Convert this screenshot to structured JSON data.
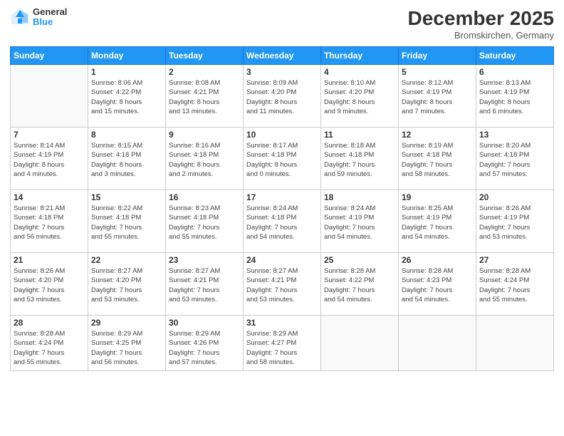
{
  "logo": {
    "general": "General",
    "blue": "Blue"
  },
  "title": "December 2025",
  "subtitle": "Bromskirchen, Germany",
  "weekdays": [
    "Sunday",
    "Monday",
    "Tuesday",
    "Wednesday",
    "Thursday",
    "Friday",
    "Saturday"
  ],
  "weeks": [
    [
      {
        "day": "",
        "info": ""
      },
      {
        "day": "1",
        "info": "Sunrise: 8:06 AM\nSunset: 4:22 PM\nDaylight: 8 hours\nand 15 minutes."
      },
      {
        "day": "2",
        "info": "Sunrise: 8:08 AM\nSunset: 4:21 PM\nDaylight: 8 hours\nand 13 minutes."
      },
      {
        "day": "3",
        "info": "Sunrise: 8:09 AM\nSunset: 4:20 PM\nDaylight: 8 hours\nand 11 minutes."
      },
      {
        "day": "4",
        "info": "Sunrise: 8:10 AM\nSunset: 4:20 PM\nDaylight: 8 hours\nand 9 minutes."
      },
      {
        "day": "5",
        "info": "Sunrise: 8:12 AM\nSunset: 4:19 PM\nDaylight: 8 hours\nand 7 minutes."
      },
      {
        "day": "6",
        "info": "Sunrise: 8:13 AM\nSunset: 4:19 PM\nDaylight: 8 hours\nand 6 minutes."
      }
    ],
    [
      {
        "day": "7",
        "info": "Sunrise: 8:14 AM\nSunset: 4:19 PM\nDaylight: 8 hours\nand 4 minutes."
      },
      {
        "day": "8",
        "info": "Sunrise: 8:15 AM\nSunset: 4:18 PM\nDaylight: 8 hours\nand 3 minutes."
      },
      {
        "day": "9",
        "info": "Sunrise: 8:16 AM\nSunset: 4:18 PM\nDaylight: 8 hours\nand 2 minutes."
      },
      {
        "day": "10",
        "info": "Sunrise: 8:17 AM\nSunset: 4:18 PM\nDaylight: 8 hours\nand 0 minutes."
      },
      {
        "day": "11",
        "info": "Sunrise: 8:18 AM\nSunset: 4:18 PM\nDaylight: 7 hours\nand 59 minutes."
      },
      {
        "day": "12",
        "info": "Sunrise: 8:19 AM\nSunset: 4:18 PM\nDaylight: 7 hours\nand 58 minutes."
      },
      {
        "day": "13",
        "info": "Sunrise: 8:20 AM\nSunset: 4:18 PM\nDaylight: 7 hours\nand 57 minutes."
      }
    ],
    [
      {
        "day": "14",
        "info": "Sunrise: 8:21 AM\nSunset: 4:18 PM\nDaylight: 7 hours\nand 56 minutes."
      },
      {
        "day": "15",
        "info": "Sunrise: 8:22 AM\nSunset: 4:18 PM\nDaylight: 7 hours\nand 55 minutes."
      },
      {
        "day": "16",
        "info": "Sunrise: 8:23 AM\nSunset: 4:18 PM\nDaylight: 7 hours\nand 55 minutes."
      },
      {
        "day": "17",
        "info": "Sunrise: 8:24 AM\nSunset: 4:18 PM\nDaylight: 7 hours\nand 54 minutes."
      },
      {
        "day": "18",
        "info": "Sunrise: 8:24 AM\nSunset: 4:19 PM\nDaylight: 7 hours\nand 54 minutes."
      },
      {
        "day": "19",
        "info": "Sunrise: 8:25 AM\nSunset: 4:19 PM\nDaylight: 7 hours\nand 54 minutes."
      },
      {
        "day": "20",
        "info": "Sunrise: 8:26 AM\nSunset: 4:19 PM\nDaylight: 7 hours\nand 53 minutes."
      }
    ],
    [
      {
        "day": "21",
        "info": "Sunrise: 8:26 AM\nSunset: 4:20 PM\nDaylight: 7 hours\nand 53 minutes."
      },
      {
        "day": "22",
        "info": "Sunrise: 8:27 AM\nSunset: 4:20 PM\nDaylight: 7 hours\nand 53 minutes."
      },
      {
        "day": "23",
        "info": "Sunrise: 8:27 AM\nSunset: 4:21 PM\nDaylight: 7 hours\nand 53 minutes."
      },
      {
        "day": "24",
        "info": "Sunrise: 8:27 AM\nSunset: 4:21 PM\nDaylight: 7 hours\nand 53 minutes."
      },
      {
        "day": "25",
        "info": "Sunrise: 8:28 AM\nSunset: 4:22 PM\nDaylight: 7 hours\nand 54 minutes."
      },
      {
        "day": "26",
        "info": "Sunrise: 8:28 AM\nSunset: 4:23 PM\nDaylight: 7 hours\nand 54 minutes."
      },
      {
        "day": "27",
        "info": "Sunrise: 8:28 AM\nSunset: 4:24 PM\nDaylight: 7 hours\nand 55 minutes."
      }
    ],
    [
      {
        "day": "28",
        "info": "Sunrise: 8:28 AM\nSunset: 4:24 PM\nDaylight: 7 hours\nand 55 minutes."
      },
      {
        "day": "29",
        "info": "Sunrise: 8:29 AM\nSunset: 4:25 PM\nDaylight: 7 hours\nand 56 minutes."
      },
      {
        "day": "30",
        "info": "Sunrise: 8:29 AM\nSunset: 4:26 PM\nDaylight: 7 hours\nand 57 minutes."
      },
      {
        "day": "31",
        "info": "Sunrise: 8:29 AM\nSunset: 4:27 PM\nDaylight: 7 hours\nand 58 minutes."
      },
      {
        "day": "",
        "info": ""
      },
      {
        "day": "",
        "info": ""
      },
      {
        "day": "",
        "info": ""
      }
    ]
  ]
}
